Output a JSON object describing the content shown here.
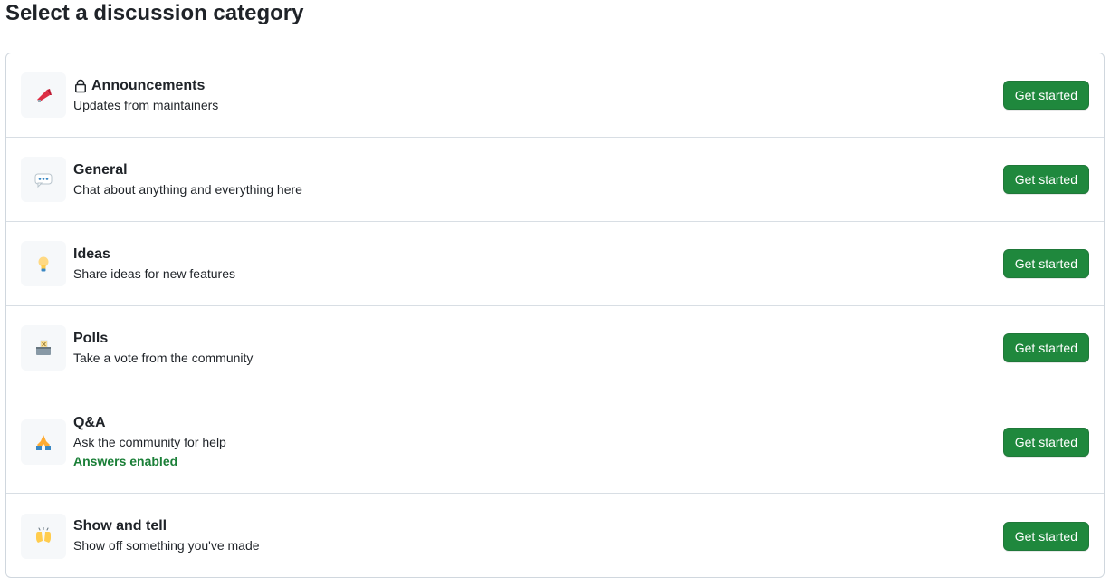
{
  "page": {
    "title": "Select a discussion category"
  },
  "categories": [
    {
      "name": "Announcements",
      "description": "Updates from maintainers",
      "emoji": "megaphone-icon",
      "locked": true,
      "button_label": "Get started"
    },
    {
      "name": "General",
      "description": "Chat about anything and everything here",
      "emoji": "speech-balloon-icon",
      "button_label": "Get started"
    },
    {
      "name": "Ideas",
      "description": "Share ideas for new features",
      "emoji": "light-bulb-icon",
      "button_label": "Get started"
    },
    {
      "name": "Polls",
      "description": "Take a vote from the community",
      "emoji": "ballot-box-icon",
      "button_label": "Get started"
    },
    {
      "name": "Q&A",
      "description": "Ask the community for help",
      "note": "Answers enabled",
      "emoji": "pray-icon",
      "button_label": "Get started"
    },
    {
      "name": "Show and tell",
      "description": "Show off something you've made",
      "emoji": "raised-hands-icon",
      "button_label": "Get started"
    }
  ],
  "colors": {
    "button_bg": "#1f883d",
    "note_green": "#1a7f37",
    "border": "#d0d7de",
    "emoji_bg": "#f6f8fa"
  }
}
